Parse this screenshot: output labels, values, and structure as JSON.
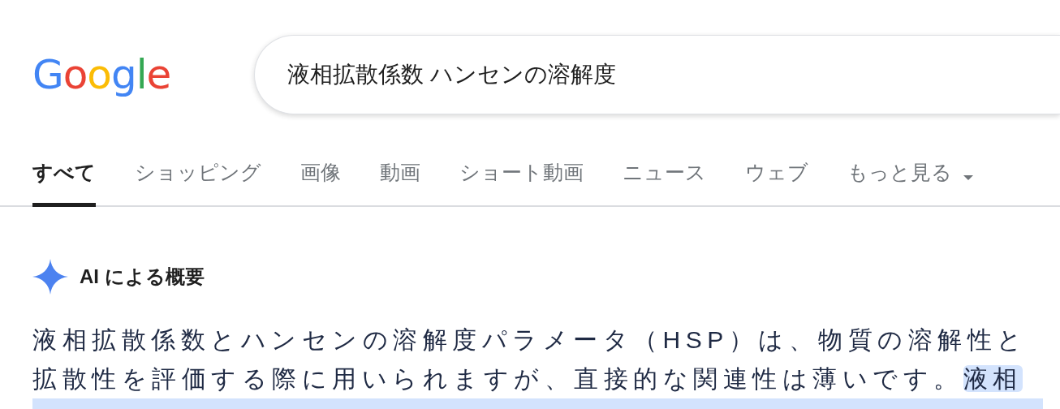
{
  "logo": {
    "text": "Google"
  },
  "search": {
    "value": "液相拡散係数 ハンセンの溶解度"
  },
  "tabs": [
    {
      "label": "すべて",
      "selected": true
    },
    {
      "label": "ショッピング",
      "selected": false
    },
    {
      "label": "画像",
      "selected": false
    },
    {
      "label": "動画",
      "selected": false
    },
    {
      "label": "ショート動画",
      "selected": false
    },
    {
      "label": "ニュース",
      "selected": false
    },
    {
      "label": "ウェブ",
      "selected": false
    },
    {
      "label": "もっと見る",
      "selected": false,
      "kind": "menu"
    }
  ],
  "ai_overview": {
    "title": "AI による概要",
    "summary": "液相拡散係数とハンセンの溶解度パラメータ（HSP）は、物質の溶解性と拡散性を評価する際に用いられますが、直接的な関連性は薄いです。",
    "highlight": "液相"
  }
}
